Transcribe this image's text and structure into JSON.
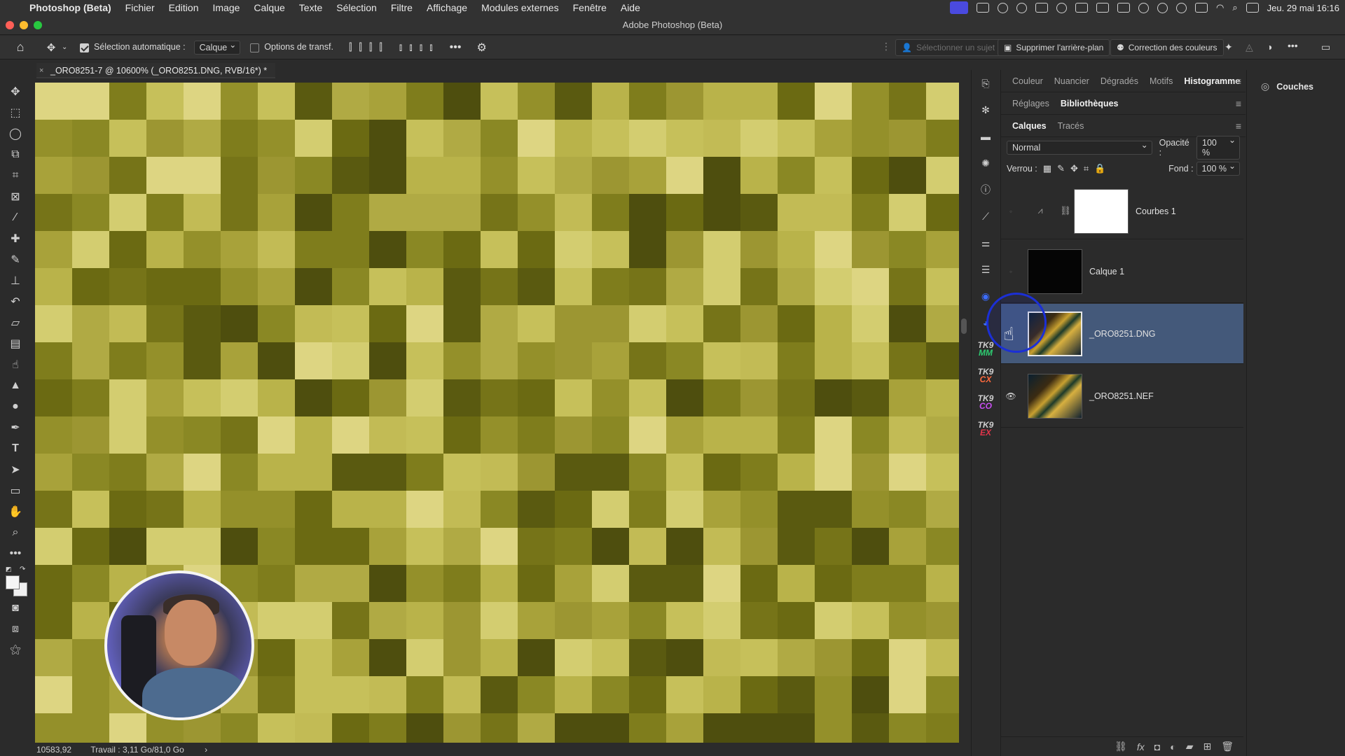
{
  "menubar": {
    "app_name": "Photoshop (Beta)",
    "items": [
      "Fichier",
      "Edition",
      "Image",
      "Calque",
      "Texte",
      "Sélection",
      "Filtre",
      "Affichage",
      "Modules externes",
      "Fenêtre",
      "Aide"
    ],
    "datetime": "Jeu. 29 mai  16:16"
  },
  "window": {
    "title": "Adobe Photoshop (Beta)"
  },
  "options": {
    "auto_select_label": "Sélection automatique :",
    "auto_select_value": "Calque",
    "transform_options_label": "Options de transf.",
    "select_subject_label": "Sélectionner un sujet",
    "remove_bg_label": "Supprimer l'arrière-plan",
    "color_correction_label": "Correction des couleurs"
  },
  "document": {
    "tab_title": "_ORO8251-7 @ 10600% (_ORO8251.DNG, RVB/16*) *"
  },
  "status": {
    "zoom": "10583,92",
    "work": "Travail : 3,11 Go/81,0 Go"
  },
  "panels": {
    "top_tabs": [
      "Couleur",
      "Nuancier",
      "Dégradés",
      "Motifs",
      "Histogramme"
    ],
    "top_active": "Histogramme",
    "mid_tabs": [
      "Réglages",
      "Bibliothèques"
    ],
    "mid_active": "Bibliothèques",
    "layer_tabs": [
      "Calques",
      "Tracés"
    ],
    "layer_active": "Calques",
    "blend_mode": "Normal",
    "opacity_label": "Opacité :",
    "opacity_value": "100 %",
    "lock_label": "Verrou :",
    "fill_label": "Fond :",
    "fill_value": "100 %",
    "layers": [
      {
        "name": "Courbes 1"
      },
      {
        "name": "Calque 1"
      },
      {
        "name": "_ORO8251.DNG"
      },
      {
        "name": "_ORO8251.NEF"
      }
    ]
  },
  "far_right": {
    "couches_label": "Couches"
  },
  "strip_labels": [
    [
      "TK9",
      "MM"
    ],
    [
      "TK9",
      "CX"
    ],
    [
      "TK9",
      "CO"
    ],
    [
      "TK9",
      "EX"
    ]
  ],
  "colors": {
    "active_layer": "#44597a",
    "cursor_circle": "#1b2fd6",
    "tk_mm": "#2ecc71",
    "tk_cx": "#ff6a3d",
    "tk_co": "#c64df0",
    "tk_ex": "#e2344a"
  }
}
